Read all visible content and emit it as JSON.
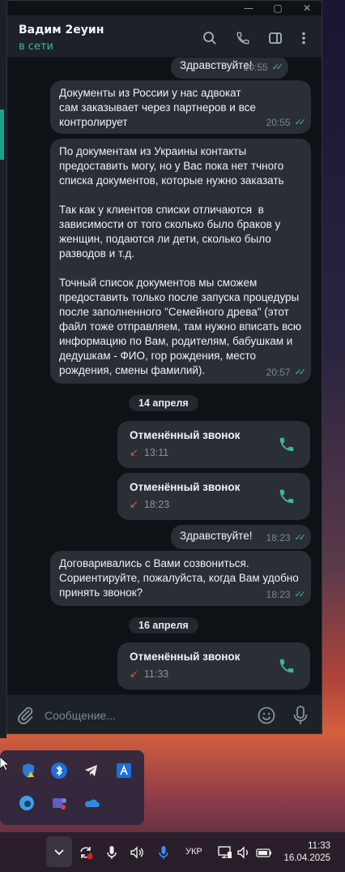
{
  "window": {
    "controls": {
      "minimize": "—",
      "maximize": "▢",
      "close": "✕"
    }
  },
  "header": {
    "contact_name": "Вадим 2еуин",
    "status": "в сети",
    "icons": [
      "search-icon",
      "phone-icon",
      "sidebar-icon",
      "more-icon"
    ]
  },
  "messages": [
    {
      "text": "Здравствуйте!",
      "time": "20:55",
      "read": true
    },
    {
      "text": "Документы из России у нас адвокат сам заказывает через партнеров и все контролирует",
      "time": "20:55",
      "read": true
    },
    {
      "text": "По документам из Украины контакты предоставить могу, но у Вас пока нет тчного списка документов, которые нужно заказать\n\nТак как у клиентов списки отличаются  в зависимости от того сколько было браков у женщин, подаются ли дети, сколько было разводов и т.д.\n\nТочный список документов мы сможем предоставить только после запуска процедуры после заполненного \"Семейного древа\" (этот файл тоже отправляем, там нужно вписать всю информацию по Вам, родителям, бабушкам и дедушкам - ФИО, гор рождения, место рождения, смены фамилий).",
      "time": "20:57",
      "read": true
    },
    {
      "text": "Здравствуйте!",
      "time": "18:23",
      "read": true
    },
    {
      "text": "Договаривались с Вами созвониться. Сориентируйте, пожалуйста, когда Вам удобно принять звонок?",
      "time": "18:23",
      "read": true
    }
  ],
  "dates": [
    "14 апреля",
    "16 апреля"
  ],
  "calls": [
    {
      "title": "Отменённый звонок",
      "time": "13:11"
    },
    {
      "title": "Отменённый звонок",
      "time": "18:23"
    },
    {
      "title": "Отменённый звонок",
      "time": "11:33"
    }
  ],
  "composer": {
    "placeholder": "Сообщение..."
  },
  "taskbar": {
    "language": "УКР",
    "time": "11:33",
    "date": "16.04.2025"
  },
  "colors": {
    "accent": "#3bb89a",
    "bubble": "#2a2f36",
    "missed": "#e2553d"
  }
}
